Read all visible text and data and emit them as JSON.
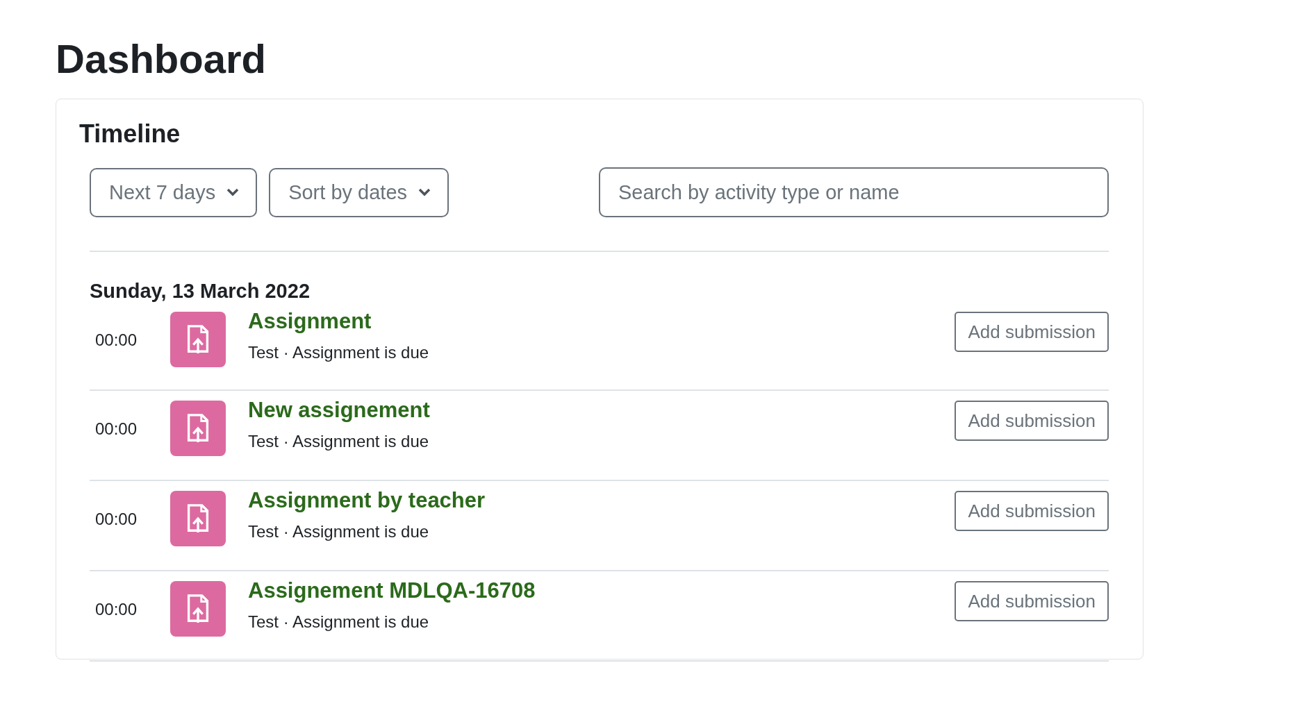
{
  "page": {
    "title": "Dashboard"
  },
  "timeline": {
    "title": "Timeline",
    "filters": [
      {
        "kind": "dropdown",
        "label": "Next 7 days"
      },
      {
        "kind": "dropdown",
        "label": "Sort by dates"
      }
    ],
    "search": {
      "placeholder": "Search by activity type or name"
    },
    "days": [
      {
        "date": "Sunday, 13 March 2022",
        "events": [
          {
            "time": "00:00",
            "name": "Assignment",
            "detail": "Test · Assignment is due",
            "action": "Add submission"
          },
          {
            "time": "00:00",
            "name": "New assignement",
            "detail": "Test · Assignment is due",
            "action": "Add submission"
          },
          {
            "time": "00:00",
            "name": "Assignment by teacher",
            "detail": "Test · Assignment is due",
            "action": "Add submission"
          },
          {
            "time": "00:00",
            "name": "Assignement MDLQA-16708",
            "detail": "Test · Assignment is due",
            "action": "Add submission"
          }
        ]
      }
    ]
  }
}
